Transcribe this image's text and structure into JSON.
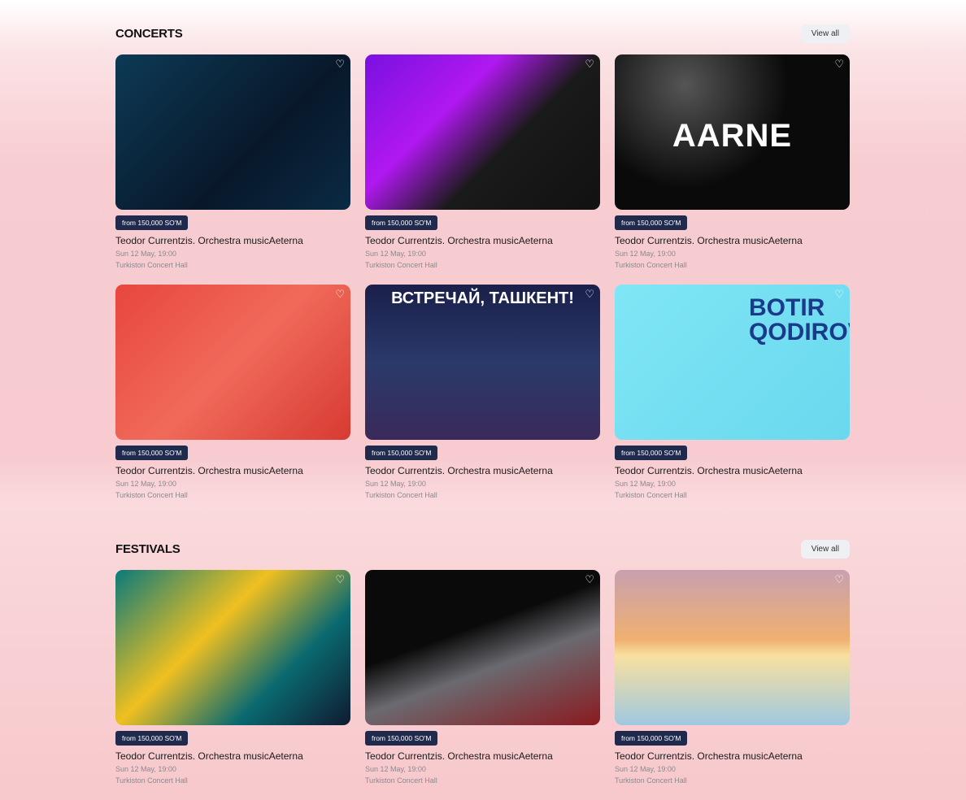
{
  "sections": [
    {
      "title": "CONCERTS",
      "view_all": "View all",
      "cards": [
        {
          "price": "from 150,000 SO'M",
          "title": "Teodor Currentzis. Orchestra musicAeterna",
          "date": "Sun 12 May, 19:00",
          "venue": "Turkiston Concert Hall",
          "bg": "linear-gradient(135deg,#0d3a55,#08182a 60%,#0a2a44)",
          "poster": ""
        },
        {
          "price": "from 150,000 SO'M",
          "title": "Teodor Currentzis. Orchestra musicAeterna",
          "date": "Sun 12 May, 19:00",
          "venue": "Turkiston Concert Hall",
          "bg": "linear-gradient(135deg,#7a10e0,#b018f0 35%,#1a1a1a 60%,#111)",
          "poster": ""
        },
        {
          "price": "from 150,000 SO'M",
          "title": "Teodor Currentzis. Orchestra musicAeterna",
          "date": "Sun 12 May, 19:00",
          "venue": "Turkiston Concert Hall",
          "bg": "radial-gradient(circle at 30% 20%,#555,#0a0a0a 50%)",
          "poster": "AARNE"
        },
        {
          "price": "from 150,000 SO'M",
          "title": "Teodor Currentzis. Orchestra musicAeterna",
          "date": "Sun 12 May, 19:00",
          "venue": "Turkiston Concert Hall",
          "bg": "linear-gradient(135deg,#e8463c,#f06a5a 50%,#d83a32)",
          "poster": ""
        },
        {
          "price": "from 150,000 SO'M",
          "title": "Teodor Currentzis. Orchestra musicAeterna",
          "date": "Sun 12 May, 19:00",
          "venue": "Turkiston Concert Hall",
          "bg": "linear-gradient(180deg,#1a1f4a,#2a3a6a 50%,#3a2a5a)",
          "poster": "ВСТРЕЧАЙ, ТАШКЕНТ!"
        },
        {
          "price": "from 150,000 SO'M",
          "title": "Teodor Currentzis. Orchestra musicAeterna",
          "date": "Sun 12 May, 19:00",
          "venue": "Turkiston Concert Hall",
          "bg": "linear-gradient(135deg,#7fe6f5,#6ad8ee)",
          "poster": "BOTIR QODIROV"
        }
      ]
    },
    {
      "title": "FESTIVALS",
      "view_all": "View all",
      "cards": [
        {
          "price": "from 150,000 SO'M",
          "title": "Teodor Currentzis. Orchestra musicAeterna",
          "date": "Sun 12 May, 19:00",
          "venue": "Turkiston Concert Hall",
          "bg": "linear-gradient(135deg,#0a7a7a,#f0c020 40%,#0a6a70 70%,#101a30)",
          "poster": ""
        },
        {
          "price": "from 150,000 SO'M",
          "title": "Teodor Currentzis. Orchestra musicAeterna",
          "date": "Sun 12 May, 19:00",
          "venue": "Turkiston Concert Hall",
          "bg": "linear-gradient(160deg,#0a0a0a 40%,#6a6a70 60%,#8a1a20)",
          "poster": ""
        },
        {
          "price": "from 150,000 SO'M",
          "title": "Teodor Currentzis. Orchestra musicAeterna",
          "date": "Sun 12 May, 19:00",
          "venue": "Turkiston Concert Hall",
          "bg": "linear-gradient(180deg,#c8a0b0,#f0b070 45%,#f8e0a0 55%,#a0c8e0)",
          "poster": ""
        }
      ]
    }
  ]
}
